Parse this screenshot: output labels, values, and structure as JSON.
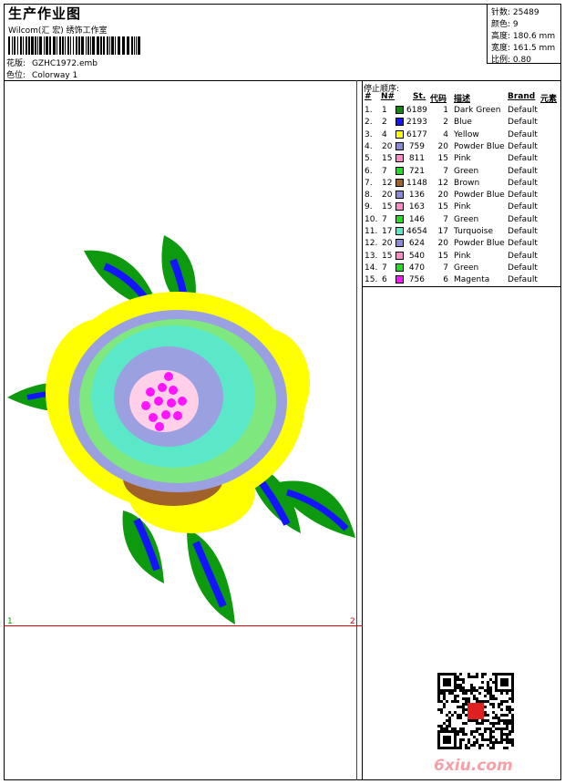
{
  "header": {
    "title": "生产作业图",
    "company": "Wilcom(汇 宏) 绣饰工作室",
    "design_label": "花版:",
    "design_value": "GZHC1972.emb",
    "color_label": "色位:",
    "color_value": "Colorway 1"
  },
  "stats": {
    "stitches_label": "针数:",
    "stitches": "25489",
    "colors_label": "颜色:",
    "colors": "9",
    "height_label": "高度:",
    "height": "180.6 mm",
    "width_label": "宽度:",
    "width": "161.5 mm",
    "scale_label": "比例:",
    "scale": "0.80"
  },
  "table": {
    "title": "停止顺序:",
    "headers": [
      "#",
      "N#",
      "St.",
      "代码",
      "描述",
      "Brand",
      "元素"
    ],
    "rows": [
      {
        "idx": "1.",
        "n": "1",
        "color": "#0e8a0e",
        "st": "6189",
        "code": "1",
        "desc": "Dark Green",
        "brand": "Default"
      },
      {
        "idx": "2.",
        "n": "2",
        "color": "#1414ff",
        "st": "2193",
        "code": "2",
        "desc": "Blue",
        "brand": "Default"
      },
      {
        "idx": "3.",
        "n": "4",
        "color": "#ffff00",
        "st": "6177",
        "code": "4",
        "desc": "Yellow",
        "brand": "Default"
      },
      {
        "idx": "4.",
        "n": "20",
        "color": "#8a8ad8",
        "st": "759",
        "code": "20",
        "desc": "Powder Blue",
        "brand": "Default"
      },
      {
        "idx": "5.",
        "n": "15",
        "color": "#ff8ac8",
        "st": "811",
        "code": "15",
        "desc": "Pink",
        "brand": "Default"
      },
      {
        "idx": "6.",
        "n": "7",
        "color": "#22dd22",
        "st": "721",
        "code": "7",
        "desc": "Green",
        "brand": "Default"
      },
      {
        "idx": "7.",
        "n": "12",
        "color": "#a0622a",
        "st": "1148",
        "code": "12",
        "desc": "Brown",
        "brand": "Default"
      },
      {
        "idx": "8.",
        "n": "20",
        "color": "#8a8ad8",
        "st": "136",
        "code": "20",
        "desc": "Powder Blue",
        "brand": "Default"
      },
      {
        "idx": "9.",
        "n": "15",
        "color": "#ff8ac8",
        "st": "163",
        "code": "15",
        "desc": "Pink",
        "brand": "Default"
      },
      {
        "idx": "10.",
        "n": "7",
        "color": "#22dd22",
        "st": "146",
        "code": "7",
        "desc": "Green",
        "brand": "Default"
      },
      {
        "idx": "11.",
        "n": "17",
        "color": "#5ae8c8",
        "st": "4654",
        "code": "17",
        "desc": "Turquoise",
        "brand": "Default"
      },
      {
        "idx": "12.",
        "n": "20",
        "color": "#8a8ad8",
        "st": "624",
        "code": "20",
        "desc": "Powder Blue",
        "brand": "Default"
      },
      {
        "idx": "13.",
        "n": "15",
        "color": "#ff8ac8",
        "st": "540",
        "code": "15",
        "desc": "Pink",
        "brand": "Default"
      },
      {
        "idx": "14.",
        "n": "7",
        "color": "#22dd22",
        "st": "470",
        "code": "7",
        "desc": "Green",
        "brand": "Default"
      },
      {
        "idx": "15.",
        "n": "6",
        "color": "#ff14ff",
        "st": "756",
        "code": "6",
        "desc": "Magenta",
        "brand": "Default"
      }
    ]
  },
  "canvas": {
    "label_left": "1",
    "label_right": "2"
  },
  "watermark": "6xiu.com"
}
